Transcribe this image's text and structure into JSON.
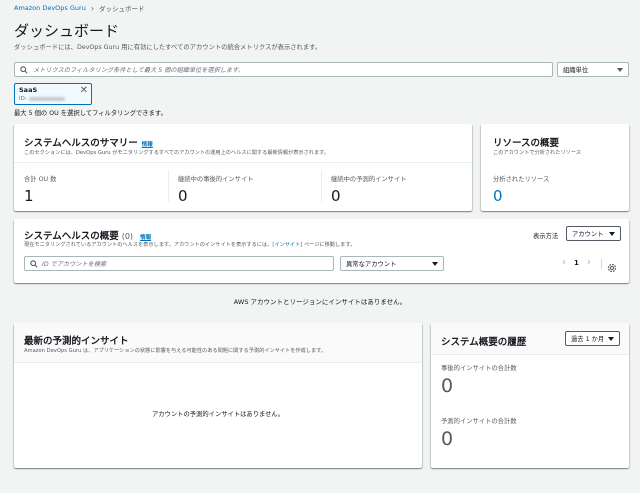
{
  "breadcrumb": {
    "service": "Amazon DevOps Guru",
    "current": "ダッシュボード"
  },
  "page": {
    "title": "ダッシュボード",
    "description": "ダッシュボードには、DevOps Guru 用に有効にしたすべてのアカウントの統合メトリクスが表示されます。"
  },
  "filter": {
    "placeholder": "メトリクスのフィルタリング条件として最大 5 個の組織単位を選択します。",
    "unit_select": "組織単位",
    "token_name": "SaaS",
    "token_id_prefix": "ID:",
    "hint": "最大 5 個の OU を選択してフィルタリングできます。"
  },
  "health_summary": {
    "title": "システムヘルスのサマリー",
    "info": "情報",
    "subtitle": "このセクションには、DevOps Guru がモニタリングするすべてのアカウントの運用上のヘルスに関する最新情報が表示されます。",
    "metrics": [
      {
        "label": "合計 OU 数",
        "value": "1"
      },
      {
        "label": "継続中の事後的インサイト",
        "value": "0"
      },
      {
        "label": "継続中の予測的インサイト",
        "value": "0"
      }
    ]
  },
  "resources": {
    "title": "リソースの概要",
    "subtitle": "このアカウントで分析されたリソース",
    "label": "分析されたリソース",
    "value": "0"
  },
  "health_overview": {
    "title": "システムヘルスの概要",
    "count": "(0)",
    "info": "情報",
    "subtitle_pre": "現在モニタリングされているアカウントのヘルスを表示します。アカウントのインサイトを表示するには、",
    "subtitle_link": "[インサイト]",
    "subtitle_post": " ページに移動します。",
    "view_label": "表示方法",
    "view_value": "アカウント",
    "search_placeholder": "ID でアカウントを検索",
    "status_filter": "異常なアカウント",
    "page_number": "1",
    "prev": "‹",
    "next": "›"
  },
  "no_insights_message": "AWS アカウントとリージョンにインサイトはありません。",
  "predictive": {
    "title": "最新の予測的インサイト",
    "subtitle": "Amazon DevOps Guru は、アプリケーションの状態に影響を与える可能性のある問題に関する予測的インサイトを作成します。",
    "empty": "アカウントの予測的インサイトはありません。"
  },
  "history": {
    "title": "システム概要の履歴",
    "range": "過去 1 か月",
    "reactive_label": "事後的インサイトの合計数",
    "reactive_value": "0",
    "proactive_label": "予測的インサイトの合計数",
    "proactive_value": "0"
  },
  "colors": {
    "link": "#0073bb",
    "text": "#16191f",
    "muted": "#545b64",
    "background": "#f2f3f3"
  }
}
